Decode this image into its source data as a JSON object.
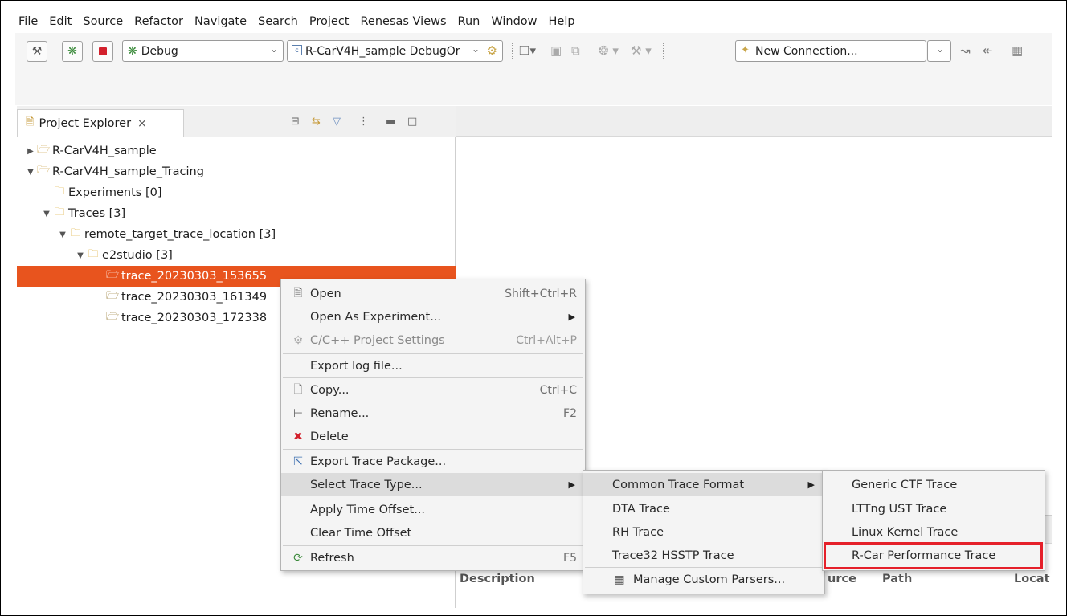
{
  "menubar": [
    "File",
    "Edit",
    "Source",
    "Refactor",
    "Navigate",
    "Search",
    "Project",
    "Renesas Views",
    "Run",
    "Window",
    "Help"
  ],
  "toolbar": {
    "build_icon": "hammer-icon",
    "debug_icon": "bug-icon",
    "stop_icon": "stop-icon",
    "launch_mode": "Debug",
    "launch_config": "R-CarV4H_sample DebugOr",
    "connection": "New Connection..."
  },
  "project_explorer": {
    "title": "Project Explorer",
    "close": "×",
    "tree": [
      {
        "label": "R-CarV4H_sample",
        "expanded": false,
        "level": 0
      },
      {
        "label": "R-CarV4H_sample_Tracing",
        "expanded": true,
        "level": 0
      },
      {
        "label": "Experiments [0]",
        "level": 1
      },
      {
        "label": "Traces [3]",
        "expanded": true,
        "level": 1
      },
      {
        "label": "remote_target_trace_location [3]",
        "expanded": true,
        "level": 2
      },
      {
        "label": "e2studio [3]",
        "expanded": true,
        "level": 3
      },
      {
        "label": "trace_20230303_153655",
        "level": 4,
        "selected": true
      },
      {
        "label": "trace_20230303_161349",
        "level": 4
      },
      {
        "label": "trace_20230303_172338",
        "level": 4
      }
    ]
  },
  "context_menu": {
    "items": [
      {
        "label": "Open",
        "accel": "Shift+Ctrl+R",
        "icon": "file-icon"
      },
      {
        "label": "Open As Experiment...",
        "submenu": true
      },
      {
        "label": "C/C++ Project Settings",
        "accel": "Ctrl+Alt+P",
        "icon": "settings-icon",
        "disabled": true
      },
      {
        "label": "Export log file..."
      },
      {
        "label": "Copy...",
        "accel": "Ctrl+C",
        "icon": "copy-icon"
      },
      {
        "label": "Rename...",
        "accel": "F2",
        "icon": "rename-icon"
      },
      {
        "label": "Delete",
        "icon": "delete-icon"
      },
      {
        "label": "Export Trace Package...",
        "icon": "export-icon"
      },
      {
        "label": "Select Trace Type...",
        "submenu": true,
        "hover": true
      },
      {
        "label": "Apply Time Offset..."
      },
      {
        "label": "Clear Time Offset"
      },
      {
        "label": "Refresh",
        "accel": "F5",
        "icon": "refresh-icon"
      }
    ]
  },
  "trace_type_menu": {
    "items": [
      {
        "label": "Common Trace Format",
        "submenu": true,
        "hover": true
      },
      {
        "label": "DTA Trace"
      },
      {
        "label": "RH Trace"
      },
      {
        "label": "Trace32 HSSTP Trace"
      },
      {
        "label": "Manage Custom Parsers...",
        "icon": "parsers-icon"
      }
    ]
  },
  "ctf_menu": {
    "items": [
      {
        "label": "Generic CTF Trace"
      },
      {
        "label": "LTTng UST Trace"
      },
      {
        "label": "Linux Kernel Trace"
      },
      {
        "label": "R-Car Performance Trace",
        "highlighted": true
      }
    ]
  },
  "bottom_panel": {
    "columns": [
      "Description",
      "urce",
      "Path",
      "Locat"
    ]
  },
  "colors": {
    "selection": "#e8541e",
    "highlight_box": "#e5202a"
  }
}
